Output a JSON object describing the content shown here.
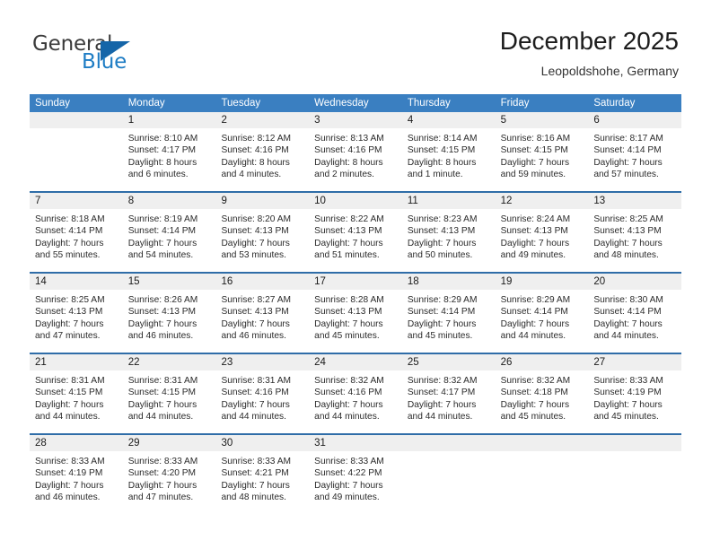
{
  "brand": {
    "name_part1": "General",
    "name_part2": "Blue",
    "accent_color": "#1d7cc4",
    "triangle_color": "#1565a8"
  },
  "header": {
    "title": "December 2025",
    "subtitle": "Leopoldshohe, Germany"
  },
  "calendar": {
    "header_bg": "#3a7fc1",
    "daynum_band": "#efefef",
    "weekday_headers": [
      "Sunday",
      "Monday",
      "Tuesday",
      "Wednesday",
      "Thursday",
      "Friday",
      "Saturday"
    ],
    "weeks": [
      [
        {
          "day": "",
          "lines": []
        },
        {
          "day": "1",
          "lines": [
            "Sunrise: 8:10 AM",
            "Sunset: 4:17 PM",
            "Daylight: 8 hours",
            "and 6 minutes."
          ]
        },
        {
          "day": "2",
          "lines": [
            "Sunrise: 8:12 AM",
            "Sunset: 4:16 PM",
            "Daylight: 8 hours",
            "and 4 minutes."
          ]
        },
        {
          "day": "3",
          "lines": [
            "Sunrise: 8:13 AM",
            "Sunset: 4:16 PM",
            "Daylight: 8 hours",
            "and 2 minutes."
          ]
        },
        {
          "day": "4",
          "lines": [
            "Sunrise: 8:14 AM",
            "Sunset: 4:15 PM",
            "Daylight: 8 hours",
            "and 1 minute."
          ]
        },
        {
          "day": "5",
          "lines": [
            "Sunrise: 8:16 AM",
            "Sunset: 4:15 PM",
            "Daylight: 7 hours",
            "and 59 minutes."
          ]
        },
        {
          "day": "6",
          "lines": [
            "Sunrise: 8:17 AM",
            "Sunset: 4:14 PM",
            "Daylight: 7 hours",
            "and 57 minutes."
          ]
        }
      ],
      [
        {
          "day": "7",
          "lines": [
            "Sunrise: 8:18 AM",
            "Sunset: 4:14 PM",
            "Daylight: 7 hours",
            "and 55 minutes."
          ]
        },
        {
          "day": "8",
          "lines": [
            "Sunrise: 8:19 AM",
            "Sunset: 4:14 PM",
            "Daylight: 7 hours",
            "and 54 minutes."
          ]
        },
        {
          "day": "9",
          "lines": [
            "Sunrise: 8:20 AM",
            "Sunset: 4:13 PM",
            "Daylight: 7 hours",
            "and 53 minutes."
          ]
        },
        {
          "day": "10",
          "lines": [
            "Sunrise: 8:22 AM",
            "Sunset: 4:13 PM",
            "Daylight: 7 hours",
            "and 51 minutes."
          ]
        },
        {
          "day": "11",
          "lines": [
            "Sunrise: 8:23 AM",
            "Sunset: 4:13 PM",
            "Daylight: 7 hours",
            "and 50 minutes."
          ]
        },
        {
          "day": "12",
          "lines": [
            "Sunrise: 8:24 AM",
            "Sunset: 4:13 PM",
            "Daylight: 7 hours",
            "and 49 minutes."
          ]
        },
        {
          "day": "13",
          "lines": [
            "Sunrise: 8:25 AM",
            "Sunset: 4:13 PM",
            "Daylight: 7 hours",
            "and 48 minutes."
          ]
        }
      ],
      [
        {
          "day": "14",
          "lines": [
            "Sunrise: 8:25 AM",
            "Sunset: 4:13 PM",
            "Daylight: 7 hours",
            "and 47 minutes."
          ]
        },
        {
          "day": "15",
          "lines": [
            "Sunrise: 8:26 AM",
            "Sunset: 4:13 PM",
            "Daylight: 7 hours",
            "and 46 minutes."
          ]
        },
        {
          "day": "16",
          "lines": [
            "Sunrise: 8:27 AM",
            "Sunset: 4:13 PM",
            "Daylight: 7 hours",
            "and 46 minutes."
          ]
        },
        {
          "day": "17",
          "lines": [
            "Sunrise: 8:28 AM",
            "Sunset: 4:13 PM",
            "Daylight: 7 hours",
            "and 45 minutes."
          ]
        },
        {
          "day": "18",
          "lines": [
            "Sunrise: 8:29 AM",
            "Sunset: 4:14 PM",
            "Daylight: 7 hours",
            "and 45 minutes."
          ]
        },
        {
          "day": "19",
          "lines": [
            "Sunrise: 8:29 AM",
            "Sunset: 4:14 PM",
            "Daylight: 7 hours",
            "and 44 minutes."
          ]
        },
        {
          "day": "20",
          "lines": [
            "Sunrise: 8:30 AM",
            "Sunset: 4:14 PM",
            "Daylight: 7 hours",
            "and 44 minutes."
          ]
        }
      ],
      [
        {
          "day": "21",
          "lines": [
            "Sunrise: 8:31 AM",
            "Sunset: 4:15 PM",
            "Daylight: 7 hours",
            "and 44 minutes."
          ]
        },
        {
          "day": "22",
          "lines": [
            "Sunrise: 8:31 AM",
            "Sunset: 4:15 PM",
            "Daylight: 7 hours",
            "and 44 minutes."
          ]
        },
        {
          "day": "23",
          "lines": [
            "Sunrise: 8:31 AM",
            "Sunset: 4:16 PM",
            "Daylight: 7 hours",
            "and 44 minutes."
          ]
        },
        {
          "day": "24",
          "lines": [
            "Sunrise: 8:32 AM",
            "Sunset: 4:16 PM",
            "Daylight: 7 hours",
            "and 44 minutes."
          ]
        },
        {
          "day": "25",
          "lines": [
            "Sunrise: 8:32 AM",
            "Sunset: 4:17 PM",
            "Daylight: 7 hours",
            "and 44 minutes."
          ]
        },
        {
          "day": "26",
          "lines": [
            "Sunrise: 8:32 AM",
            "Sunset: 4:18 PM",
            "Daylight: 7 hours",
            "and 45 minutes."
          ]
        },
        {
          "day": "27",
          "lines": [
            "Sunrise: 8:33 AM",
            "Sunset: 4:19 PM",
            "Daylight: 7 hours",
            "and 45 minutes."
          ]
        }
      ],
      [
        {
          "day": "28",
          "lines": [
            "Sunrise: 8:33 AM",
            "Sunset: 4:19 PM",
            "Daylight: 7 hours",
            "and 46 minutes."
          ]
        },
        {
          "day": "29",
          "lines": [
            "Sunrise: 8:33 AM",
            "Sunset: 4:20 PM",
            "Daylight: 7 hours",
            "and 47 minutes."
          ]
        },
        {
          "day": "30",
          "lines": [
            "Sunrise: 8:33 AM",
            "Sunset: 4:21 PM",
            "Daylight: 7 hours",
            "and 48 minutes."
          ]
        },
        {
          "day": "31",
          "lines": [
            "Sunrise: 8:33 AM",
            "Sunset: 4:22 PM",
            "Daylight: 7 hours",
            "and 49 minutes."
          ]
        },
        {
          "day": "",
          "lines": []
        },
        {
          "day": "",
          "lines": []
        },
        {
          "day": "",
          "lines": []
        }
      ]
    ]
  }
}
